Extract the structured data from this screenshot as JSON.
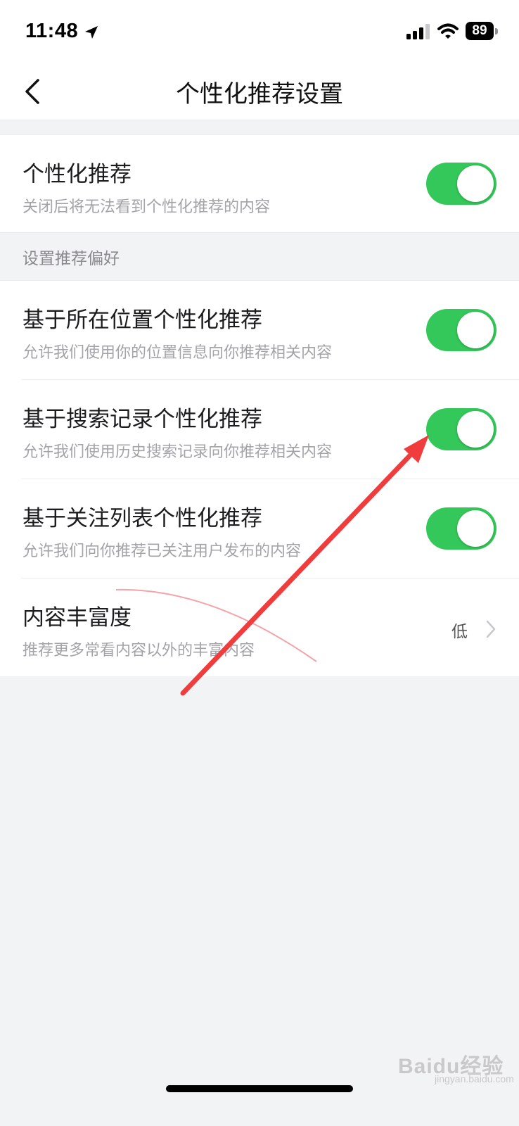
{
  "status_bar": {
    "time": "11:48",
    "battery": "89"
  },
  "nav": {
    "title": "个性化推荐设置"
  },
  "personalized": {
    "title": "个性化推荐",
    "desc": "关闭后将无法看到个性化推荐的内容",
    "enabled": true
  },
  "section": {
    "label": "设置推荐偏好"
  },
  "preferences": [
    {
      "title": "基于所在位置个性化推荐",
      "desc": "允许我们使用你的位置信息向你推荐相关内容",
      "enabled": true
    },
    {
      "title": "基于搜索记录个性化推荐",
      "desc": "允许我们使用历史搜索记录向你推荐相关内容",
      "enabled": true
    },
    {
      "title": "基于关注列表个性化推荐",
      "desc": "允许我们向你推荐已关注用户发布的内容",
      "enabled": true
    }
  ],
  "richness": {
    "title": "内容丰富度",
    "desc": "推荐更多常看内容以外的丰富内容",
    "value": "低"
  },
  "watermark": {
    "brand": "Baidu经验",
    "url": "jingyan.baidu.com"
  },
  "colors": {
    "toggle_on": "#34c759",
    "annotation_arrow": "#f03c3c"
  }
}
